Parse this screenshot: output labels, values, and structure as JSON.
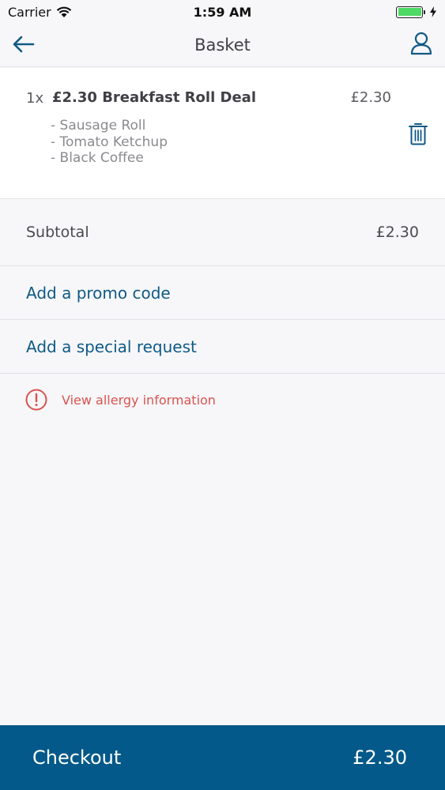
{
  "status_bar": {
    "carrier": "Carrier",
    "time": "1:59 AM",
    "battery_level": 1.0
  },
  "nav": {
    "title": "Basket",
    "back_icon": "back-arrow-icon",
    "user_icon": "user-icon"
  },
  "basket": {
    "items": [
      {
        "quantity": "1x",
        "name": "£2.30 Breakfast Roll Deal",
        "price": "£2.30",
        "options": [
          "- Sausage Roll",
          "- Tomato Ketchup",
          "- Black Coffee"
        ],
        "delete_icon": "trash-icon"
      }
    ]
  },
  "summary": {
    "subtotal_label": "Subtotal",
    "subtotal_value": "£2.30"
  },
  "links": {
    "promo": "Add a promo code",
    "special_request": "Add a special request",
    "allergy": "View allergy information"
  },
  "checkout": {
    "label": "Checkout",
    "total": "£2.30"
  },
  "colors": {
    "accent": "#0f5a85",
    "checkout_bg": "#035989",
    "warning": "#d9534f",
    "battery": "#4cd964"
  }
}
